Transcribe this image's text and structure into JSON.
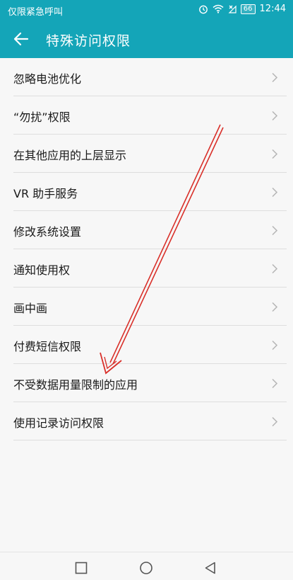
{
  "status_bar": {
    "carrier": "仅限紧急呼叫",
    "battery": "66",
    "time": "12:44"
  },
  "header": {
    "title": "特殊访问权限"
  },
  "list": {
    "items": [
      {
        "label": "忽略电池优化"
      },
      {
        "label": "“勿扰”权限"
      },
      {
        "label": "在其他应用的上层显示"
      },
      {
        "label": "VR 助手服务"
      },
      {
        "label": "修改系统设置"
      },
      {
        "label": "通知使用权"
      },
      {
        "label": "画中画"
      },
      {
        "label": "付费短信权限"
      },
      {
        "label": "不受数据用量限制的应用"
      },
      {
        "label": "使用记录访问权限"
      }
    ]
  },
  "nav_bar": {
    "icons": [
      "recent-apps-icon",
      "home-icon",
      "back-triangle-icon"
    ]
  },
  "colors": {
    "accent": "#14a5b8",
    "annotation": "#d9302a",
    "background": "#f7f7f7"
  }
}
